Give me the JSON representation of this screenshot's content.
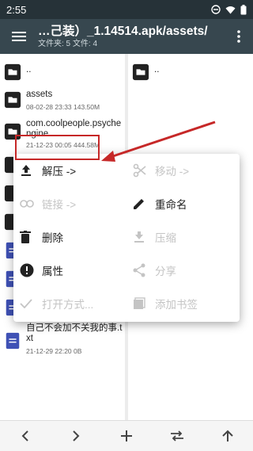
{
  "status_bar": {
    "time": "2:55"
  },
  "toolbar": {
    "title": "…己装）_1.14514.apk/assets/",
    "subtitle": "文件夹: 5  文件: 4"
  },
  "left_pane": {
    "rows": [
      {
        "name": "..",
        "meta": "",
        "icon": "folder-icon"
      },
      {
        "name": "assets",
        "meta": "08-02-28 23:33  143.50M",
        "icon": "folder-icon"
      },
      {
        "name": "com.coolpeople.psychengine",
        "meta": "21-12-23 00:05  444.58M",
        "icon": "folder-icon"
      },
      {
        "name": "自己不会加不关我的事.txt",
        "meta": "21-12-29 22:20  0B",
        "icon": "text-file-icon"
      }
    ]
  },
  "right_pane": {
    "rows": [
      {
        "name": "..",
        "icon": "folder-icon"
      }
    ]
  },
  "context_menu": {
    "items": [
      {
        "label": "解压 ->",
        "icon": "unzip-icon",
        "enabled": true
      },
      {
        "label": "移动 ->",
        "icon": "cut-icon",
        "enabled": false
      },
      {
        "label": "链接 ->",
        "icon": "link-icon",
        "enabled": false
      },
      {
        "label": "重命名",
        "icon": "rename-icon",
        "enabled": true
      },
      {
        "label": "删除",
        "icon": "delete-icon",
        "enabled": true
      },
      {
        "label": "压缩",
        "icon": "compress-icon",
        "enabled": false
      },
      {
        "label": "属性",
        "icon": "info-icon",
        "enabled": true
      },
      {
        "label": "分享",
        "icon": "share-icon",
        "enabled": false
      },
      {
        "label": "打开方式...",
        "icon": "open-with-icon",
        "enabled": false
      },
      {
        "label": "添加书签",
        "icon": "bookmark-icon",
        "enabled": false
      }
    ]
  },
  "bottom_bar": {
    "buttons": [
      "back-icon",
      "forward-icon",
      "add-icon",
      "swap-icon",
      "up-icon"
    ]
  },
  "colors": {
    "toolbar": "#37474f",
    "status_bar": "#263238",
    "highlight": "#c62828",
    "folder": "#222222",
    "text_file": "#3f51b5"
  }
}
